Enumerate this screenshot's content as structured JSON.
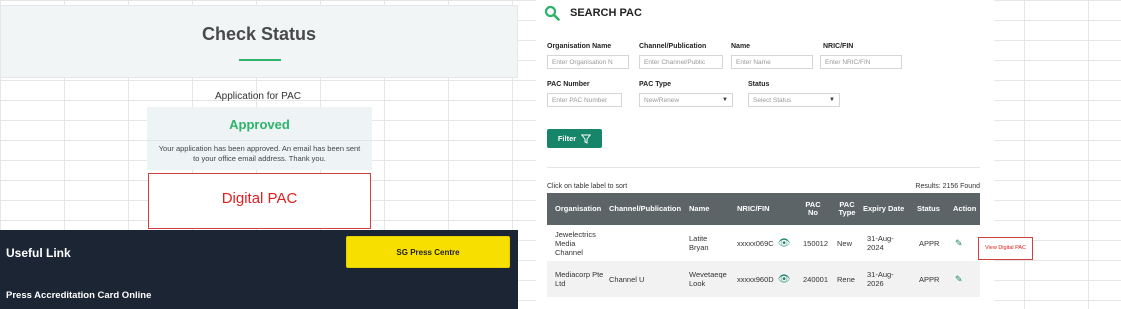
{
  "check_status": {
    "title": "Check Status",
    "application_label": "Application for PAC",
    "status": "Approved",
    "message": "Your application has been approved. An email has been sent to your office email address. Thank you.",
    "digital_pac": "Digital PAC"
  },
  "footer": {
    "useful_link": "Useful Link",
    "press_centre_button": "SG Press Centre",
    "press_card_online": "Press Accreditation Card Online"
  },
  "search_pac": {
    "title": "SEARCH PAC",
    "fields": {
      "org_name": {
        "label": "Organisation Name",
        "placeholder": "Enter Organisation N"
      },
      "channel": {
        "label": "Channel/Publication",
        "placeholder": "Enter Channel/Public"
      },
      "name": {
        "label": "Name",
        "placeholder": "Enter Name"
      },
      "nric": {
        "label": "NRIC/FIN",
        "placeholder": "Enter NRIC/FIN"
      },
      "pac_number": {
        "label": "PAC Number",
        "placeholder": "Enter PAC Number"
      },
      "pac_type": {
        "label": "PAC Type",
        "value": "New/Renew"
      },
      "status": {
        "label": "Status",
        "value": "Select Status"
      }
    },
    "filter_button": "Filter",
    "sort_hint": "Click on table label to sort",
    "results": "Results: 2156 Found",
    "columns": {
      "org": "Organisation",
      "channel": "Channel/Publication",
      "name": "Name",
      "nric": "NRIC/FIN",
      "pac_no": "PAC No",
      "pac_type": "PAC Type",
      "expiry": "Expiry Date",
      "status": "Status",
      "action": "Action"
    },
    "rows": [
      {
        "org": "Jewelectrics Media Channel",
        "channel": "",
        "name": "Latite Bryan",
        "nric": "xxxxx069C",
        "pac_no": "150012",
        "pac_type": "New",
        "expiry": "31-Aug-2024",
        "status": "APPR"
      },
      {
        "org": "Mediacorp Pte Ltd",
        "channel": "Channel U",
        "name": "Wevetaeqe Look",
        "nric": "xxxxx960D",
        "pac_no": "240001",
        "pac_type": "Rene",
        "expiry": "31-Aug-2026",
        "status": "APPR"
      }
    ],
    "view_digital_note": "View Digital PAC"
  },
  "icons": {
    "search": "search-icon",
    "filter": "filter-icon",
    "eye": "eye-icon",
    "edit": "pencil-icon"
  },
  "colors": {
    "accent_green": "#16856a",
    "approved_green": "#2db36a",
    "highlight_red": "#e02020",
    "footer_dark": "#1c2534",
    "press_yellow": "#f7e000"
  }
}
